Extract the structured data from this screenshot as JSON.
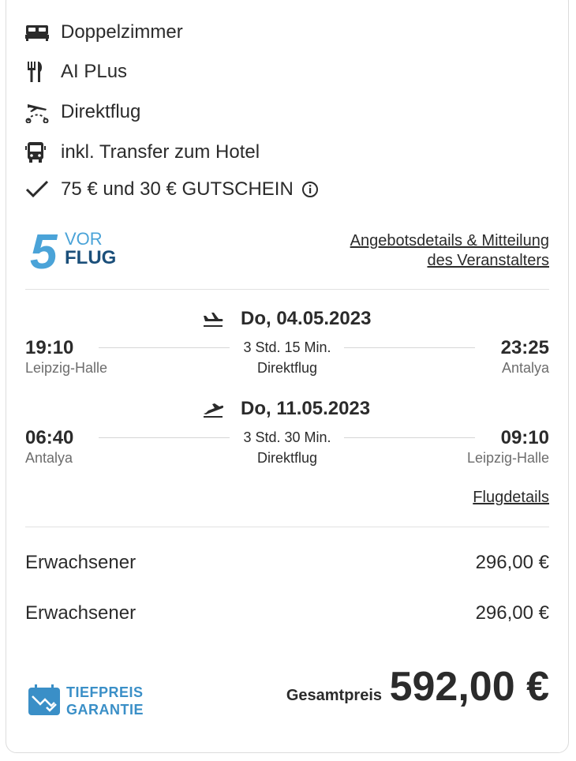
{
  "features": [
    {
      "icon": "bed-icon",
      "label": "Doppelzimmer"
    },
    {
      "icon": "cutlery-icon",
      "label": "AI PLus"
    },
    {
      "icon": "direct-flight-icon",
      "label": "Direktflug"
    },
    {
      "icon": "bus-icon",
      "label": "inkl. Transfer zum Hotel"
    },
    {
      "icon": "checkmark-icon",
      "label": "75 € und 30 € GUTSCHEIN"
    }
  ],
  "operator": {
    "logo_text_top": "VOR",
    "logo_text_bottom": "FLUG",
    "logo_number": "5",
    "details_link_line1": "Angebotsdetails & Mitteilung",
    "details_link_line2": "des Veranstalters"
  },
  "flights": [
    {
      "direction_icon": "plane-departure-icon",
      "date": "Do, 04.05.2023",
      "dep_time": "19:10",
      "dep_city": "Leipzig-Halle",
      "duration": "3 Std. 15 Min.",
      "type": "Direktflug",
      "arr_time": "23:25",
      "arr_city": "Antalya"
    },
    {
      "direction_icon": "plane-return-icon",
      "date": "Do, 11.05.2023",
      "dep_time": "06:40",
      "dep_city": "Antalya",
      "duration": "3 Std. 30 Min.",
      "type": "Direktflug",
      "arr_time": "09:10",
      "arr_city": "Leipzig-Halle"
    }
  ],
  "flight_details_link": "Flugdetails",
  "passengers": [
    {
      "label": "Erwachsener",
      "price": "296,00 €"
    },
    {
      "label": "Erwachsener",
      "price": "296,00 €"
    }
  ],
  "guarantee": {
    "line1": "TIEFPREIS",
    "line2": "GARANTIE"
  },
  "total": {
    "label": "Gesamtpreis",
    "price": "592,00 €"
  },
  "colors": {
    "text": "#2b2b2b",
    "muted": "#6d6d6d",
    "brand_blue": "#3a8fc7",
    "logo_blue": "#4aa3d8",
    "logo_dark": "#1b4f7a"
  }
}
